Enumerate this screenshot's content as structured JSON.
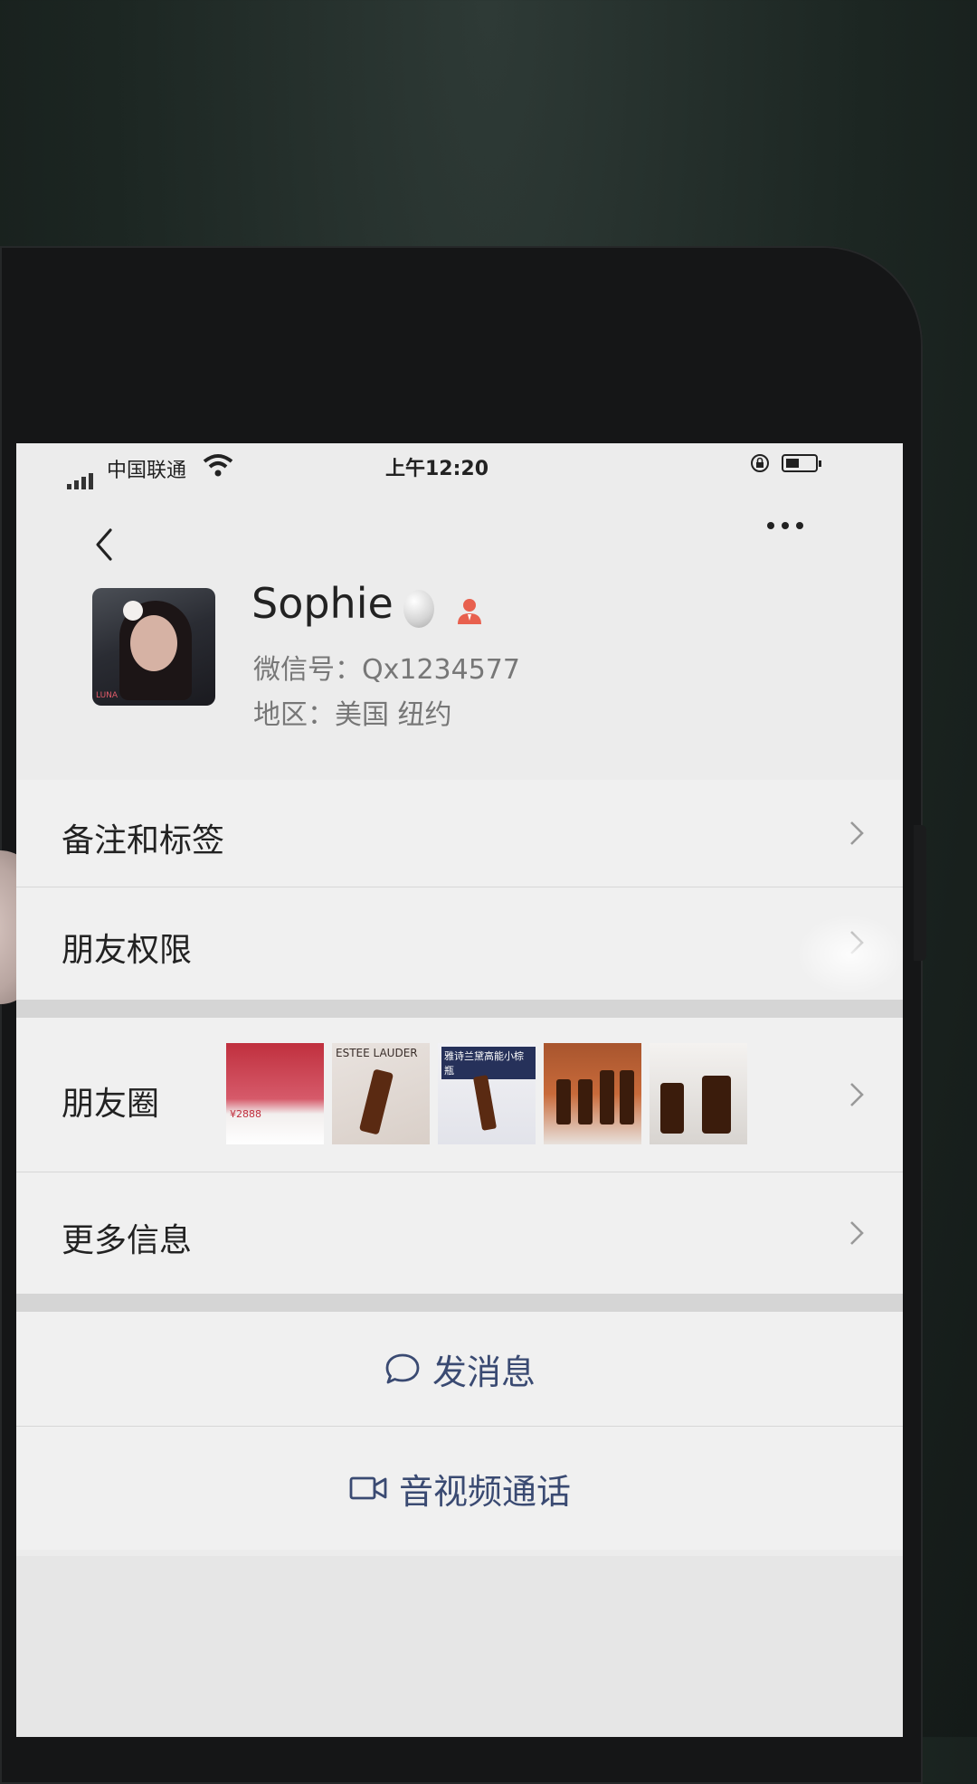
{
  "status_bar": {
    "carrier": "中国联通",
    "time": "上午12:20"
  },
  "profile": {
    "name": "Sophie",
    "wechat_id": "微信号：Qx1234577",
    "region": "地区：美国 纽约",
    "avatar_watermark": "LUNA"
  },
  "menu": {
    "remarks_label": "备注和标签",
    "permissions_label": "朋友权限",
    "moments_label": "朋友圈",
    "more_info_label": "更多信息"
  },
  "moments_thumbs": [
    {
      "caption": "¥2888"
    },
    {
      "caption": "ESTEE LAUDER"
    },
    {
      "caption": "雅诗兰黛高能小棕瓶"
    },
    {
      "caption": ""
    },
    {
      "caption": ""
    }
  ],
  "actions": {
    "message_label": "发消息",
    "call_label": "音视频通话"
  },
  "colors": {
    "action_text": "#3a4a72",
    "badge_red": "#e8604e"
  }
}
